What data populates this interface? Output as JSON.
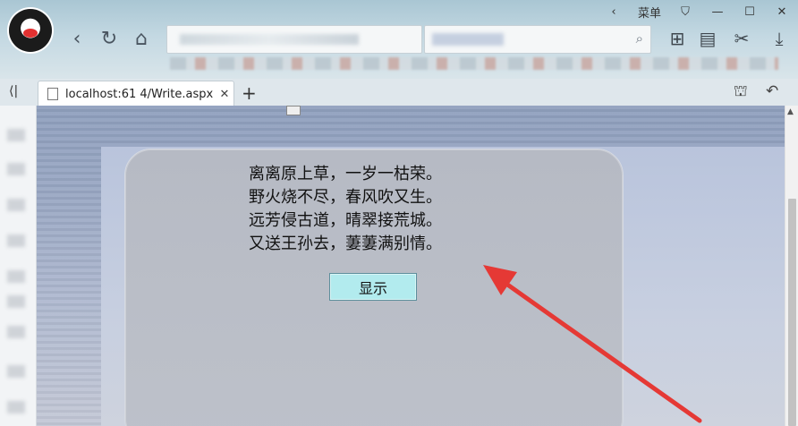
{
  "window": {
    "menu_label": "菜单",
    "minimize_glyph": "—",
    "maximize_glyph": "☐",
    "close_glyph": "✕"
  },
  "nav": {
    "back_glyph": "‹",
    "refresh_glyph": "↻",
    "home_glyph": "⌂"
  },
  "tab": {
    "title": "localhost:61 4/Write.aspx",
    "close_glyph": "✕",
    "new_glyph": "+"
  },
  "page": {
    "poem_lines": [
      "离离原上草，一岁一枯荣。",
      "野火烧不尽，春风吹又生。",
      "远芳侵古道，晴翠接荒城。",
      "又送王孙去，萋萋满别情。"
    ],
    "show_button_label": "显示"
  },
  "colors": {
    "button_bg": "#b2ebee",
    "annotation_arrow": "#e53935"
  }
}
